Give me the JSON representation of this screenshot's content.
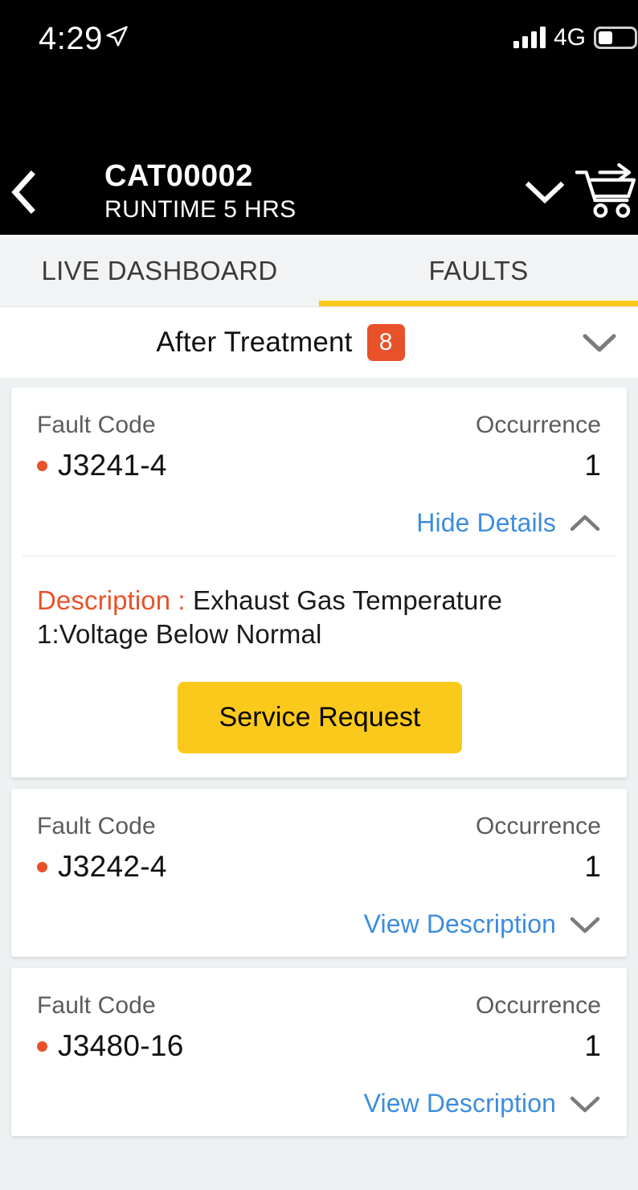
{
  "status_bar": {
    "time": "4:29",
    "location_icon": "location-arrow-icon",
    "signal_icon": "signal-bars-icon",
    "network": "4G",
    "battery_icon": "battery-icon"
  },
  "header": {
    "back_icon": "chevron-left-icon",
    "title": "CAT00002",
    "subtitle": "RUNTIME 5 HRS",
    "dropdown_icon": "chevron-down-icon",
    "cart_icon": "cart-arrow-icon"
  },
  "tabs": [
    {
      "label": "LIVE DASHBOARD",
      "active": false
    },
    {
      "label": "FAULTS",
      "active": true
    }
  ],
  "group": {
    "title": "After Treatment",
    "count": "8",
    "chevron_icon": "chevron-down-icon"
  },
  "columns": {
    "fault_code": "Fault Code",
    "occurrence": "Occurrence"
  },
  "faults": [
    {
      "code": "J3241-4",
      "occurrence": "1",
      "expanded": true,
      "toggle_label": "Hide Details",
      "toggle_icon": "chevron-up-icon",
      "description_label": "Description :",
      "description_text": "Exhaust Gas Temperature 1:Voltage Below Normal",
      "action_button": "Service Request"
    },
    {
      "code": "J3242-4",
      "occurrence": "1",
      "expanded": false,
      "toggle_label": "View Description",
      "toggle_icon": "chevron-down-icon"
    },
    {
      "code": "J3480-16",
      "occurrence": "1",
      "expanded": false,
      "toggle_label": "View Description",
      "toggle_icon": "chevron-down-icon"
    }
  ],
  "colors": {
    "accent_yellow": "#fbc91b",
    "accent_orange": "#e8522a",
    "link_blue": "#3c8dde",
    "page_background": "#edf1f2",
    "bar_black": "#000000"
  }
}
